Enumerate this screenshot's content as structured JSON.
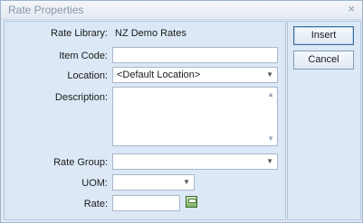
{
  "window": {
    "title": "Rate Properties",
    "close_glyph": "×"
  },
  "form": {
    "rate_library_label": "Rate Library:",
    "rate_library_value": "NZ Demo Rates",
    "item_code_label": "Item Code:",
    "item_code_value": "",
    "location_label": "Location:",
    "location_value": "<Default Location>",
    "description_label": "Description:",
    "description_value": "",
    "rate_group_label": "Rate Group:",
    "rate_group_value": "",
    "uom_label": "UOM:",
    "uom_value": "",
    "rate_label": "Rate:",
    "rate_value": ""
  },
  "buttons": {
    "insert_label": "Insert",
    "cancel_label": "Cancel"
  },
  "icons": {
    "dropdown": "chevron-down-icon",
    "scroll_up": "scroll-up-icon",
    "scroll_down": "scroll-down-icon",
    "calculator": "calculator-icon"
  },
  "colors": {
    "panel": "#dce8f6",
    "border": "#b5c6da",
    "default_button_border": "#3c6ea0"
  }
}
